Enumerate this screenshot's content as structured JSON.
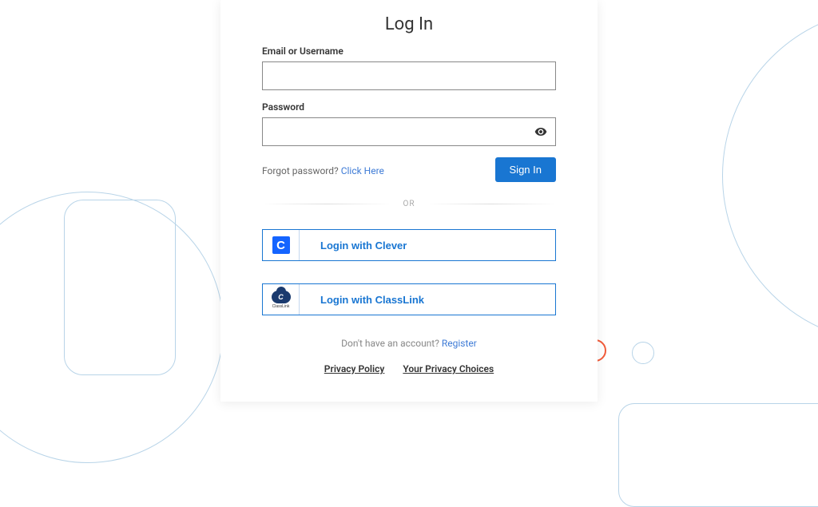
{
  "page": {
    "title": "Log In"
  },
  "form": {
    "email_label": "Email or Username",
    "password_label": "Password",
    "email_value": "",
    "password_value": "",
    "forgot_text": "Forgot password? ",
    "forgot_link": "Click Here",
    "signin_label": "Sign In"
  },
  "divider": {
    "text": "OR"
  },
  "sso": {
    "clever": {
      "label": "Login with Clever",
      "icon_letter": "C"
    },
    "classlink": {
      "label": "Login with ClassLink",
      "icon_inner": "C",
      "icon_caption": "ClassLink"
    }
  },
  "register": {
    "prompt": "Don't have an account? ",
    "link": "Register"
  },
  "footer": {
    "privacy": "Privacy Policy",
    "choices": "Your Privacy Choices"
  }
}
